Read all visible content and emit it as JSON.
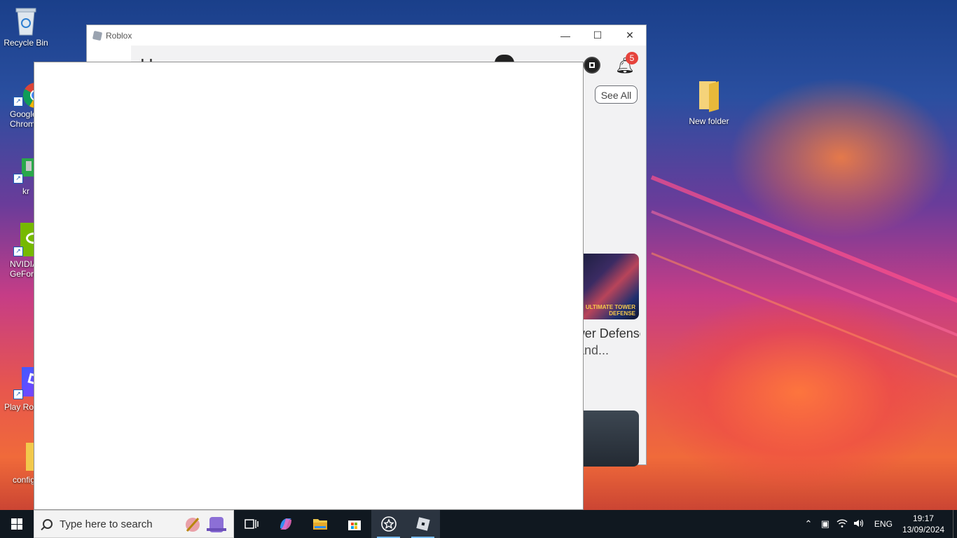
{
  "desktop": {
    "icons_left": [
      {
        "label": "Recycle Bin"
      },
      {
        "label": "Google Chrome"
      },
      {
        "label": "kr"
      },
      {
        "label": "NVIDIA GeForce"
      },
      {
        "label": "Play Roblox"
      },
      {
        "label": "config"
      }
    ],
    "icon_right": {
      "label": "New folder"
    }
  },
  "roblox_window": {
    "title": "Roblox",
    "page_title": "Home",
    "notification_count": "5",
    "see_all_label": "See All",
    "game_title": "Ultimate Tower Defense",
    "game_subtitle": "and...",
    "thumb_text": "ULTIMATE TOWER DEFENSE",
    "controls": {
      "minimize": "—",
      "maximize": "☐",
      "close": "✕"
    }
  },
  "taskbar": {
    "search_placeholder": "Type here to search",
    "language": "ENG",
    "time": "19:17",
    "date": "13/09/2024"
  }
}
